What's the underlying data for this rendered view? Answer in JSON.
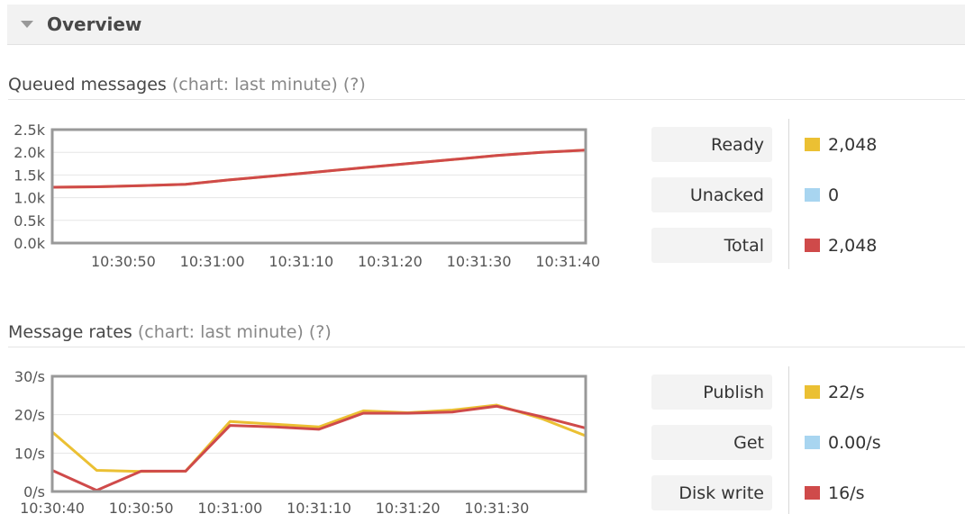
{
  "header": {
    "title": "Overview",
    "collapse_icon": "triangle-down-icon"
  },
  "queued": {
    "title": "Queued messages",
    "hint": "(chart: last minute) (?)",
    "legend": [
      {
        "label": "Ready",
        "value": "2,048",
        "color": "#ebc033"
      },
      {
        "label": "Unacked",
        "value": "0",
        "color": "#a8d5f0"
      },
      {
        "label": "Total",
        "value": "2,048",
        "color": "#cf4a4a"
      }
    ]
  },
  "rates": {
    "title": "Message rates",
    "hint": "(chart: last minute) (?)",
    "legend": [
      {
        "label": "Publish",
        "value": "22/s",
        "color": "#ebc033"
      },
      {
        "label": "Get",
        "value": "0.00/s",
        "color": "#a8d5f0"
      },
      {
        "label": "Disk write",
        "value": "16/s",
        "color": "#cf4a4a"
      }
    ]
  },
  "chart_data": [
    {
      "type": "line",
      "y_tick_labels": [
        "2.5k",
        "2.0k",
        "1.5k",
        "1.0k",
        "0.5k",
        "0.0k"
      ],
      "y_ticks": [
        2500,
        2000,
        1500,
        1000,
        500,
        0
      ],
      "ylim": [
        0,
        2500
      ],
      "xlim": [
        42,
        102
      ],
      "x_ticks": [
        50,
        60,
        70,
        80,
        90,
        100
      ],
      "x_tick_labels": [
        "10:30:50",
        "10:31:00",
        "10:31:10",
        "10:31:20",
        "10:31:30",
        "10:31:40"
      ],
      "grid": true,
      "series": [
        {
          "name": "Ready",
          "color": "#ebc033",
          "x": [
            42,
            47,
            52,
            57,
            62,
            67,
            72,
            77,
            82,
            87,
            92,
            97,
            102
          ],
          "y": [
            1230,
            1240,
            1265,
            1295,
            1395,
            1480,
            1570,
            1660,
            1750,
            1840,
            1930,
            2000,
            2048
          ]
        },
        {
          "name": "Unacked",
          "color": "#a8d5f0",
          "x": [
            42,
            102
          ],
          "y": [
            0,
            0
          ]
        },
        {
          "name": "Total",
          "color": "#cf4a4a",
          "x": [
            42,
            47,
            52,
            57,
            62,
            67,
            72,
            77,
            82,
            87,
            92,
            97,
            102
          ],
          "y": [
            1230,
            1240,
            1265,
            1295,
            1395,
            1480,
            1570,
            1660,
            1750,
            1840,
            1930,
            2000,
            2048
          ]
        }
      ]
    },
    {
      "type": "line",
      "y_tick_labels": [
        "30/s",
        "20/s",
        "10/s",
        "0/s"
      ],
      "y_ticks": [
        30,
        20,
        10,
        0
      ],
      "ylim": [
        0,
        30
      ],
      "xlim": [
        40,
        100
      ],
      "x_ticks": [
        40,
        50,
        60,
        70,
        80,
        90
      ],
      "x_tick_labels": [
        "10:30:40",
        "10:30:50",
        "10:31:00",
        "10:31:10",
        "10:31:20",
        "10:31:30"
      ],
      "grid": true,
      "series": [
        {
          "name": "Publish",
          "color": "#ebc033",
          "x": [
            40,
            45,
            50,
            55,
            60,
            65,
            70,
            75,
            80,
            85,
            90,
            95,
            100
          ],
          "y": [
            15.5,
            5.5,
            5.2,
            5.3,
            18.2,
            17.5,
            16.8,
            21,
            20.5,
            21.2,
            22.5,
            19,
            14.5
          ]
        },
        {
          "name": "Get",
          "color": "#a8d5f0",
          "x": [
            40,
            100
          ],
          "y": [
            0,
            0
          ]
        },
        {
          "name": "Disk write",
          "color": "#cf4a4a",
          "x": [
            40,
            45,
            50,
            55,
            60,
            65,
            70,
            75,
            80,
            85,
            90,
            95,
            100
          ],
          "y": [
            5.5,
            0.3,
            5.3,
            5.3,
            17.2,
            16.8,
            16.2,
            20.4,
            20.4,
            20.7,
            22.2,
            19.5,
            16.5
          ]
        }
      ]
    }
  ]
}
